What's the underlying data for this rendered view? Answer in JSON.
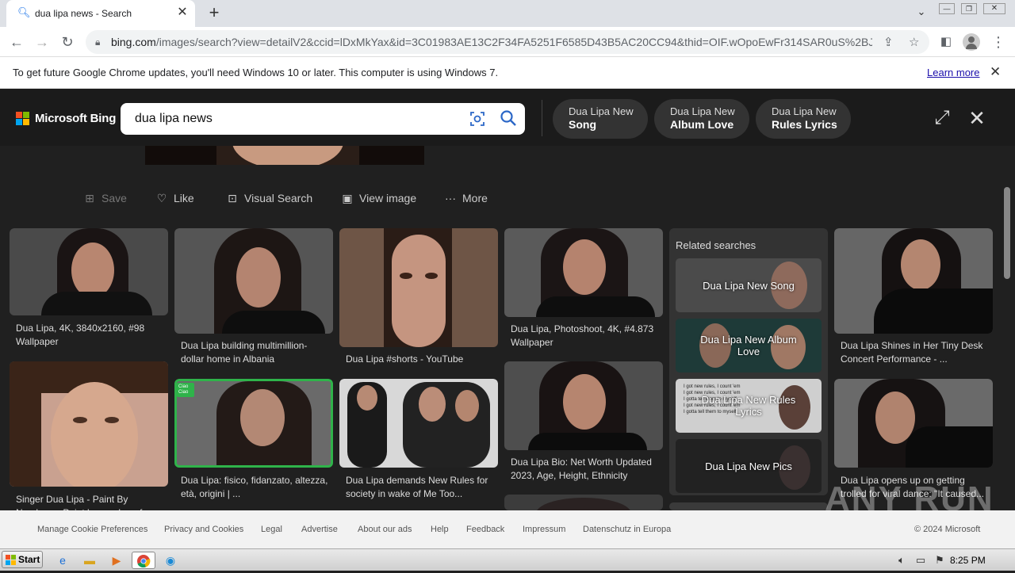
{
  "browser": {
    "tab_title": "dua lipa news - Search",
    "new_tab_label": "+",
    "url_host": "bing.com",
    "url_path": "/images/search?view=detailV2&ccid=lDxMkYax&id=3C01983AE13C2F34FA5251F6585D43B5AC20CC94&thid=OIF.wOpoEwFr314SAR0uS%2BJd..."
  },
  "infobar": {
    "message": "To get future Google Chrome updates, you'll need Windows 10 or later. This computer is using Windows 7.",
    "learn_more": "Learn more"
  },
  "bing": {
    "logo_text": "Microsoft Bing",
    "search_value": "dua lipa news",
    "pills": [
      {
        "line1": "Dua Lipa New",
        "line2": "Song"
      },
      {
        "line1": "Dua Lipa New",
        "line2": "Album Love"
      },
      {
        "line1": "Dua Lipa New",
        "line2": "Rules Lyrics"
      }
    ]
  },
  "actions": {
    "save": "Save",
    "like": "Like",
    "visual_search": "Visual Search",
    "view_image": "View image",
    "more": "More"
  },
  "results": {
    "col1": [
      {
        "caption": "Dua Lipa, 4K, 3840x2160, #98 Wallpaper"
      },
      {
        "caption": "Singer Dua Lipa - Paint By Numbers - Paint by numbers for adult"
      }
    ],
    "col2": [
      {
        "caption": "Dua Lipa building multimillion-dollar home in Albania"
      },
      {
        "caption": "Dua Lipa: fisico, fidanzato, altezza, età, origini | ..."
      }
    ],
    "col3": [
      {
        "caption": "Dua Lipa #shorts - YouTube"
      },
      {
        "caption": "Dua Lipa demands New Rules for society in wake of Me Too..."
      }
    ],
    "col4": [
      {
        "caption": "Dua Lipa, Photoshoot, 4K, #4.873 Wallpaper"
      },
      {
        "caption": "Dua Lipa Bio: Net Worth Updated 2023, Age, Height, Ethnicity"
      }
    ],
    "col6": [
      {
        "caption": "Dua Lipa Shines in Her Tiny Desk Concert Performance - ..."
      },
      {
        "caption": "Dua Lipa opens up on getting trolled for viral dance: \"It caused..."
      }
    ],
    "badge": "Ciao Ciao"
  },
  "related": {
    "title": "Related searches",
    "items": [
      {
        "label": "Dua Lipa New Song"
      },
      {
        "label": "Dua Lipa New Album Love"
      },
      {
        "label": "Dua Lipa New Rules Lyrics"
      },
      {
        "label": "Dua Lipa New Pics"
      }
    ],
    "lyrics_overlay": "I got new rules, I count 'em\nI got new rules, I count 'em\nI gotta tell them to myself\nI got new rules, I count 'em\nI gotta tell them to myself"
  },
  "footer": {
    "links": [
      "Manage Cookie Preferences",
      "Privacy and Cookies",
      "Legal",
      "Advertise",
      "About our ads",
      "Help",
      "Feedback",
      "Impressum",
      "Datenschutz in Europa"
    ],
    "copyright": "© 2024 Microsoft"
  },
  "watermark": "ANY RUN",
  "taskbar": {
    "start": "Start",
    "clock": "8:25 PM"
  }
}
